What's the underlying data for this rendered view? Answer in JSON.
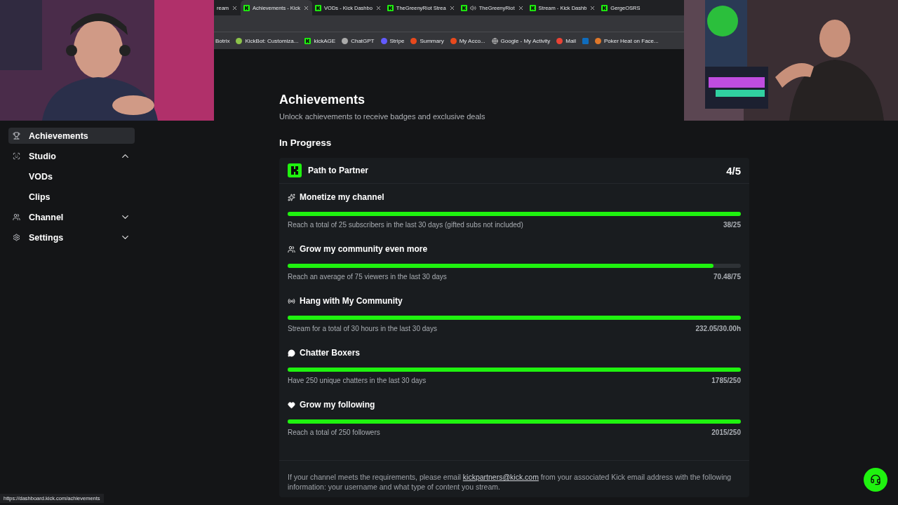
{
  "browser": {
    "tabs": [
      {
        "label": "ream",
        "selected": false,
        "muted": false
      },
      {
        "label": "Achievements - Kick",
        "selected": true,
        "muted": false
      },
      {
        "label": "VODs - Kick Dashbo",
        "selected": false,
        "muted": false
      },
      {
        "label": "TheGreenyRiot Strea",
        "selected": false,
        "muted": false
      },
      {
        "label": "TheGreenyRiot",
        "selected": false,
        "muted": true
      },
      {
        "label": "Stream - Kick Dashb",
        "selected": false,
        "muted": false
      },
      {
        "label": "GergeOSRS",
        "selected": false,
        "muted": false
      }
    ],
    "bookmarks": [
      "Botrix",
      "KickBot: Customiza...",
      "kickAGE",
      "ChatGPT",
      "Stripe",
      "Summary",
      "My Acco...",
      "Google - My Activity",
      "Mail",
      "Poker Heat on Face..."
    ],
    "status_url": "https://dashboard.kick.com/achievements"
  },
  "sidebar": {
    "items": [
      {
        "label": "Achievements",
        "selected": true
      },
      {
        "label": "Studio",
        "selected": false,
        "expanded": true,
        "children": [
          {
            "label": "VODs",
            "selected": false
          },
          {
            "label": "Clips",
            "selected": false
          }
        ]
      },
      {
        "label": "Channel",
        "selected": false,
        "expanded": false
      },
      {
        "label": "Settings",
        "selected": false,
        "expanded": false
      }
    ]
  },
  "page": {
    "title": "Achievements",
    "subtitle": "Unlock achievements to receive badges and exclusive deals",
    "section": "In Progress",
    "card": {
      "title": "Path to Partner",
      "count": "4/5",
      "achievements": [
        {
          "title": "Monetize my channel",
          "level": 1,
          "description": "Reach a total of 25 subscribers in the last 30 days (gifted subs not included)",
          "progress": "38/25"
        },
        {
          "title": "Grow my community even more",
          "level": 0.94,
          "description": "Reach an average of 75 viewers in the last 30 days",
          "progress": "70.48/75"
        },
        {
          "title": "Hang with My Community",
          "level": 1,
          "description": "Stream for a total of 30 hours in the last 30 days",
          "progress": "232.05/30.00h"
        },
        {
          "title": "Chatter Boxers",
          "level": 1,
          "description": "Have 250 unique chatters in the last 30 days",
          "progress": "1785/250"
        },
        {
          "title": "Grow my following",
          "level": 1,
          "description": "Reach a total of 250 followers",
          "progress": "2015/250"
        }
      ],
      "footer_before": "If your channel meets the requirements, please email ",
      "footer_link": "kickpartners@kick.com",
      "footer_after": " from your associated Kick email address with the following information: your username and what type of content you stream."
    }
  }
}
